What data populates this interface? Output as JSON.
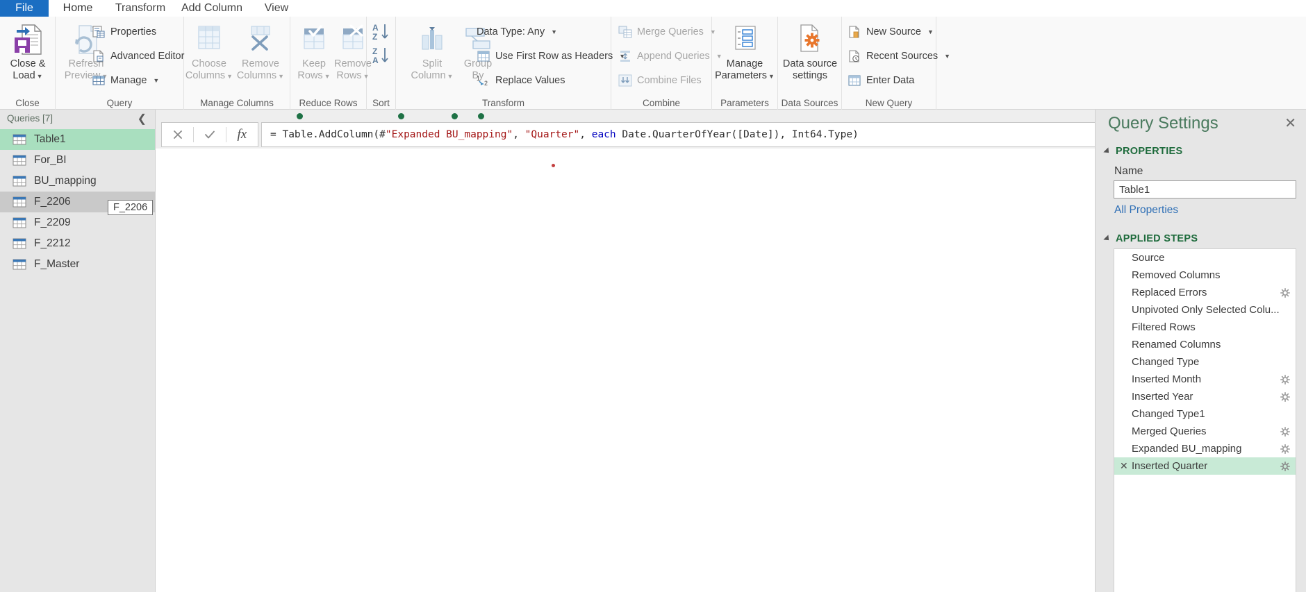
{
  "ribbon": {
    "tabs": [
      {
        "label": "File",
        "state": "file"
      },
      {
        "label": "Home",
        "state": "active"
      },
      {
        "label": "Transform",
        "state": "normal"
      },
      {
        "label": "Add Column",
        "state": "normal"
      },
      {
        "label": "View",
        "state": "normal"
      }
    ],
    "groups": [
      {
        "label": "Close"
      },
      {
        "label": "Query"
      },
      {
        "label": "Manage Columns"
      },
      {
        "label": "Reduce Rows"
      },
      {
        "label": "Sort"
      },
      {
        "label": "Transform"
      },
      {
        "label": "Combine"
      },
      {
        "label": "Parameters"
      },
      {
        "label": "Data Sources"
      },
      {
        "label": "New Query"
      }
    ],
    "close_group": {
      "close_and_load": {
        "line1": "Close &",
        "line2": "Load",
        "icon": "save-export-icon"
      }
    },
    "query_group": {
      "refresh_preview": {
        "line1": "Refresh",
        "line2": "Preview",
        "icon": "refresh-icon"
      },
      "properties": {
        "label": "Properties",
        "icon": "properties-icon"
      },
      "advanced_editor": {
        "label": "Advanced Editor",
        "icon": "advanced-editor-icon"
      },
      "manage": {
        "label": "Manage",
        "icon": "manage-table-icon"
      }
    },
    "manage_columns_group": {
      "choose_columns": {
        "line1": "Choose",
        "line2": "Columns",
        "icon": "choose-columns-icon"
      },
      "remove_columns": {
        "line1": "Remove",
        "line2": "Columns",
        "icon": "remove-columns-icon"
      }
    },
    "reduce_rows_group": {
      "keep_rows": {
        "line1": "Keep",
        "line2": "Rows",
        "icon": "keep-rows-icon"
      },
      "remove_rows": {
        "line1": "Remove",
        "line2": "Rows",
        "icon": "remove-rows-icon"
      }
    },
    "sort_group": {
      "sort_ascending": {
        "icon": "sort-az-icon"
      },
      "sort_descending": {
        "icon": "sort-za-icon"
      }
    },
    "transform_group": {
      "split_column": {
        "line1": "Split",
        "line2": "Column",
        "icon": "split-column-icon"
      },
      "group_by": {
        "line1": "Group",
        "line2": "By",
        "icon": "group-by-icon"
      },
      "data_type": {
        "label": "Data Type: Any"
      },
      "use_first_row": {
        "label": "Use First Row as Headers",
        "icon": "headers-table-icon"
      },
      "replace_values": {
        "label": "Replace Values",
        "icon": "replace-values-icon"
      }
    },
    "combine_group": {
      "merge_queries": {
        "label": "Merge Queries",
        "icon": "merge-queries-icon"
      },
      "append_queries": {
        "label": "Append Queries",
        "icon": "append-queries-icon"
      },
      "combine_files": {
        "label": "Combine Files",
        "icon": "combine-files-icon"
      }
    },
    "parameters_group": {
      "manage_parameters": {
        "line1": "Manage",
        "line2": "Parameters",
        "icon": "parameters-icon"
      }
    },
    "data_sources_group": {
      "data_source_settings": {
        "line1": "Data source",
        "line2": "settings",
        "icon": "data-source-settings-icon"
      }
    },
    "new_query_group": {
      "new_source": {
        "label": "New Source",
        "icon": "new-source-icon"
      },
      "recent_sources": {
        "label": "Recent Sources",
        "icon": "recent-sources-icon"
      },
      "enter_data": {
        "label": "Enter Data",
        "icon": "enter-data-icon"
      }
    }
  },
  "queries_pane": {
    "title": "Queries [7]",
    "collapse_icon": "chevron-left-icon",
    "items": [
      {
        "name": "Table1",
        "state": "selected"
      },
      {
        "name": "For_BI",
        "state": "normal"
      },
      {
        "name": "BU_mapping",
        "state": "normal"
      },
      {
        "name": "F_2206",
        "state": "hover"
      },
      {
        "name": "F_2209",
        "state": "normal"
      },
      {
        "name": "F_2212",
        "state": "normal"
      },
      {
        "name": "F_Master",
        "state": "normal"
      }
    ],
    "tooltip": "F_2206"
  },
  "formula_bar": {
    "cancel_icon": "x-icon",
    "commit_icon": "check-icon",
    "fx_label": "fx",
    "expand_icon": "chevron-down-icon",
    "formula_segments": [
      {
        "text": "= Table.AddColumn(#",
        "type": "plain"
      },
      {
        "text": "\"Expanded BU_mapping\"",
        "type": "string"
      },
      {
        "text": ", ",
        "type": "plain"
      },
      {
        "text": "\"Quarter\"",
        "type": "string"
      },
      {
        "text": ", ",
        "type": "plain"
      },
      {
        "text": "each",
        "type": "keyword"
      },
      {
        "text": " Date.QuarterOfYear([Date]), Int64.Type)",
        "type": "plain"
      }
    ],
    "formula_plain": "= Table.AddColumn(#\"Expanded BU_mapping\", \"Quarter\", each Date.QuarterOfYear([Date]), Int64.Type)"
  },
  "query_settings": {
    "title": "Query Settings",
    "close_icon": "close-icon",
    "properties_section": {
      "header": "PROPERTIES",
      "name_label": "Name",
      "name_value": "Table1",
      "all_properties_link": "All Properties"
    },
    "applied_steps_section": {
      "header": "APPLIED STEPS",
      "steps": [
        {
          "name": "Source",
          "gear": false,
          "selected": false
        },
        {
          "name": "Removed Columns",
          "gear": false,
          "selected": false
        },
        {
          "name": "Replaced Errors",
          "gear": true,
          "selected": false
        },
        {
          "name": "Unpivoted Only Selected Colu...",
          "gear": false,
          "selected": false
        },
        {
          "name": "Filtered Rows",
          "gear": false,
          "selected": false
        },
        {
          "name": "Renamed Columns",
          "gear": false,
          "selected": false
        },
        {
          "name": "Changed Type",
          "gear": false,
          "selected": false
        },
        {
          "name": "Inserted Month",
          "gear": true,
          "selected": false
        },
        {
          "name": "Inserted Year",
          "gear": true,
          "selected": false
        },
        {
          "name": "Changed Type1",
          "gear": false,
          "selected": false
        },
        {
          "name": "Merged Queries",
          "gear": true,
          "selected": false
        },
        {
          "name": "Expanded BU_mapping",
          "gear": true,
          "selected": false
        },
        {
          "name": "Inserted Quarter",
          "gear": true,
          "selected": true,
          "delete_icon": "x-icon"
        }
      ]
    }
  },
  "colors": {
    "file_tab_blue": "#1b6ec2",
    "selection_green": "#a9dfbf",
    "step_selected_green": "#c8ead6",
    "header_green": "#1e6b3c",
    "link_blue": "#2f6fb5",
    "dot_green": "#1e7145",
    "string_red": "#a31515",
    "keyword_blue": "#0000c0",
    "accent_orange": "#e8762c"
  }
}
